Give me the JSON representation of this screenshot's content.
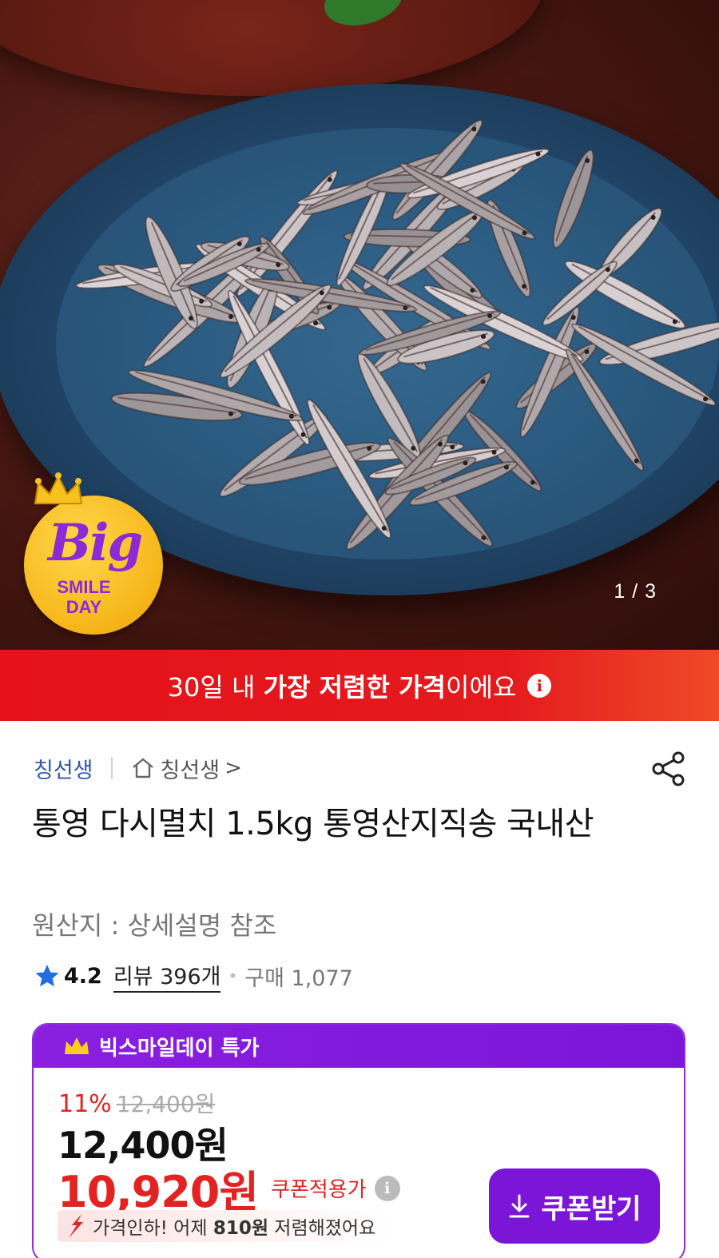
{
  "hero": {
    "page_counter": "1 / 3",
    "badge": {
      "top": "Big",
      "middle": "SMILE",
      "bottom": "DAY"
    }
  },
  "banner": {
    "prefix": "30일 내 ",
    "highlight": "가장 저렴한 가격",
    "suffix": "이에요"
  },
  "seller": {
    "brand": "칭선생",
    "store": "칭선생",
    "store_chevron": ">"
  },
  "product": {
    "title": "통영 다시멸치 1.5kg 통영산지직송 국내산",
    "origin": "원산지 : 상세설명 참조",
    "rating": "4.2",
    "review": "리뷰 396개",
    "purchase": "구매 1,077"
  },
  "price_card": {
    "header": "빅스마일데이 특가",
    "discount_rate": "11%",
    "original_price": "12,400원",
    "list_price": "12,400원",
    "sale_price": "10,920원",
    "coupon_label": "쿠폰적용가",
    "price_drop_prefix": "가격인하! 어제 ",
    "price_drop_amount": "810원",
    "price_drop_suffix": " 저렴해졌어요",
    "coupon_button": "쿠폰받기"
  },
  "colors": {
    "banner_red": "#e41a1d",
    "accent_purple": "#7b16d8",
    "price_red": "#e32222",
    "seller_blue": "#2f56a8"
  },
  "icons": [
    "crown-icon",
    "info-icon",
    "home-icon",
    "share-icon",
    "star-icon",
    "down-arrow-icon",
    "download-icon"
  ]
}
